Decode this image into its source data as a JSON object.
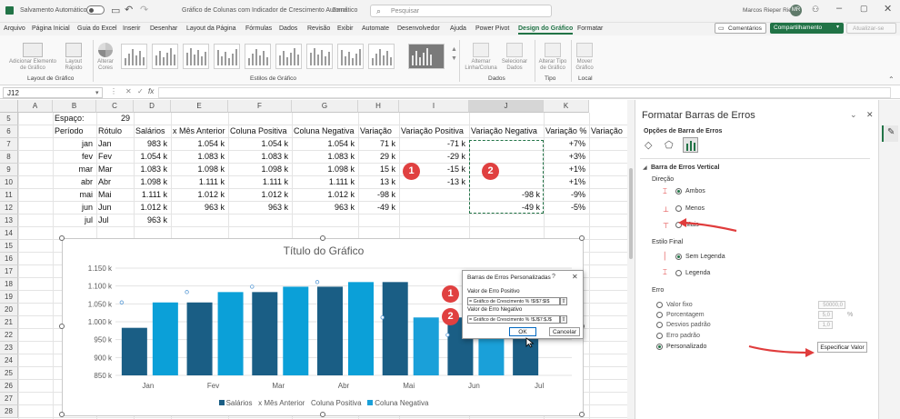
{
  "titlebar": {
    "autosave_label": "Salvamento Automático",
    "doc_title": "Gráfico de Colunas com Indicador de Crescimento Automático",
    "saved_status": "Geral",
    "search_placeholder": "Pesquisar",
    "user_name": "Marcos Rieper Rieper",
    "user_initials": "MR"
  },
  "menu": {
    "items": [
      "Arquivo",
      "Página Inicial",
      "Guia do Excel",
      "Inserir",
      "Desenhar",
      "Layout da Página",
      "Fórmulas",
      "Dados",
      "Revisão",
      "Exibir",
      "Automate",
      "Desenvolvedor",
      "Ajuda",
      "Power Pivot",
      "Design do Gráfico",
      "Formatar"
    ],
    "active_index": 14,
    "comments_label": "Comentários",
    "share_label": "Compartilhamento",
    "update_label": "Atualizar-se"
  },
  "ribbon": {
    "add_element": "Adicionar Elemento de Gráfico",
    "quick_layout": "Layout Rápido",
    "change_colors": "Alterar Cores",
    "group_layout": "Layout de Gráfico",
    "group_styles": "Estilos de Gráfico",
    "switch_row_col": "Alternar Linha/Coluna",
    "select_data": "Selecionar Dados",
    "group_data": "Dados",
    "change_type": "Alterar Tipo de Gráfico",
    "group_type": "Tipo",
    "move_chart": "Mover Gráfico",
    "group_location": "Local"
  },
  "formula_bar": {
    "name_box": "J12",
    "fx": "fx",
    "formula": ""
  },
  "columns": [
    "A",
    "B",
    "C",
    "D",
    "E",
    "F",
    "G",
    "H",
    "I",
    "J",
    "K"
  ],
  "rows": [
    "5",
    "6",
    "7",
    "8",
    "9",
    "10",
    "11",
    "12",
    "13",
    "14",
    "15",
    "16",
    "17",
    "18",
    "19",
    "20",
    "21",
    "22",
    "23",
    "24",
    "25",
    "26",
    "27",
    "28"
  ],
  "cells": {
    "espaco_label": "Espaço:",
    "espaco_value": "29",
    "headers": [
      "Período",
      "Rótulo",
      "Salários",
      "x Mês Anterior",
      "Coluna Positiva",
      "Coluna Negativa",
      "Variação",
      "Variação Positiva",
      "Variação Negativa",
      "Variação %",
      "Variação"
    ],
    "data": [
      [
        "jan",
        "Jan",
        "983 k",
        "1.054 k",
        "1.054 k",
        "1.054 k",
        "71 k",
        "-71 k",
        "",
        "+7%"
      ],
      [
        "fev",
        "Fev",
        "1.054 k",
        "1.083 k",
        "1.083 k",
        "1.083 k",
        "29 k",
        "-29 k",
        "",
        "+3%"
      ],
      [
        "mar",
        "Mar",
        "1.083 k",
        "1.098 k",
        "1.098 k",
        "1.098 k",
        "15 k",
        "-15 k",
        "",
        "+1%"
      ],
      [
        "abr",
        "Abr",
        "1.098 k",
        "1.111 k",
        "1.111 k",
        "1.111 k",
        "13 k",
        "-13 k",
        "",
        "+1%"
      ],
      [
        "mai",
        "Mai",
        "1.111 k",
        "1.012 k",
        "1.012 k",
        "1.012 k",
        "-98 k",
        "",
        "-98 k",
        "-9%"
      ],
      [
        "jun",
        "Jun",
        "1.012 k",
        "963 k",
        "963 k",
        "963 k",
        "-49 k",
        "",
        "-49 k",
        "-5%"
      ],
      [
        "jul",
        "Jul",
        "963 k",
        "",
        "",
        "",
        "",
        "",
        "",
        ""
      ]
    ]
  },
  "chart_data": {
    "type": "bar",
    "title": "Título do Gráfico",
    "categories": [
      "Jan",
      "Fev",
      "Mar",
      "Abr",
      "Mai",
      "Jun",
      "Jul"
    ],
    "ylim": [
      850,
      1150
    ],
    "yticks": [
      "850 k",
      "900 k",
      "950 k",
      "1.000 k",
      "1.050 k",
      "1.100 k",
      "1.150 k"
    ],
    "series": [
      {
        "name": "Salários",
        "values": [
          983,
          1054,
          1083,
          1098,
          1111,
          1012,
          963
        ],
        "color": "#1a5e85"
      },
      {
        "name": "x Mês Anterior",
        "values": [
          1054,
          1083,
          1098,
          1111,
          1012,
          963,
          null
        ],
        "color": "#5b9bd5"
      },
      {
        "name": "Coluna Positiva",
        "values": [
          1054,
          1083,
          1098,
          1111,
          null,
          null,
          null
        ],
        "color": "#0ba0d8"
      },
      {
        "name": "Coluna Negativa",
        "values": [
          null,
          null,
          null,
          null,
          1012,
          963,
          null
        ],
        "color": "#1aa0d9"
      }
    ],
    "legend_position": "bottom"
  },
  "dialog": {
    "title": "Barras de Erros Personalizadas",
    "help": "?",
    "pos_label": "Valor de Erro Positivo",
    "pos_value": "= Gráfico de Crescimento % !$I$7:$I$",
    "neg_label": "Valor de Erro Negativo",
    "neg_value": "= Gráfico de Crescimento % !$J$7:$J$",
    "ok": "OK",
    "cancel": "Cancelar"
  },
  "badges": [
    "1",
    "2",
    "1",
    "2"
  ],
  "panel": {
    "title": "Formatar Barras de Erros",
    "options_label": "Opções de Barra de Erros",
    "section": "Barra de Erros Vertical",
    "direction": "Direção",
    "both": "Ambos",
    "minus": "Menos",
    "plus": "Mais",
    "end_style": "Estilo Final",
    "no_cap": "Sem Legenda",
    "cap": "Legenda",
    "error": "Erro",
    "fixed": "Valor fixo",
    "fixed_val": "50000,0",
    "percent": "Porcentagem",
    "percent_val": "5,0",
    "percent_unit": "%",
    "stddev": "Desvios padrão",
    "stddev_val": "1,0",
    "stderr": "Erro padrão",
    "custom": "Personalizado",
    "specify": "Especificar Valor"
  },
  "colors": {
    "accent": "#217346",
    "arrow": "#e03c3c",
    "selection": "#217346"
  }
}
